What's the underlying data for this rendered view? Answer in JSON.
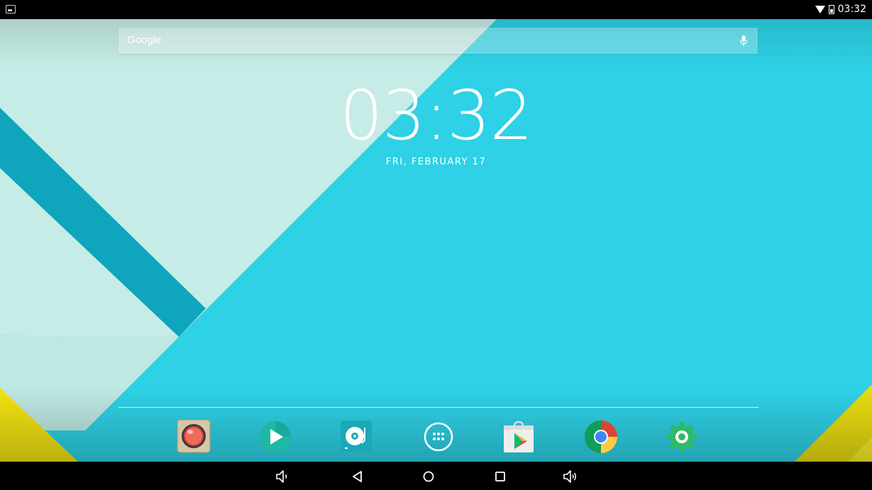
{
  "status_bar": {
    "time": "03:32",
    "icons": [
      "screenshot-notification-icon",
      "wifi-icon",
      "battery-icon"
    ]
  },
  "search": {
    "label": "Google",
    "icon": "mic-icon"
  },
  "clock_widget": {
    "time": "03:32",
    "date": "FRI, FEBRUARY 17"
  },
  "dock": {
    "apps": [
      {
        "name": "camera-app",
        "icon": "camera-lens-icon"
      },
      {
        "name": "video-player-app",
        "icon": "play-icon"
      },
      {
        "name": "music-app",
        "icon": "music-turntable-icon"
      },
      {
        "name": "all-apps",
        "icon": "app-drawer-icon"
      },
      {
        "name": "play-store-app",
        "icon": "play-store-icon"
      },
      {
        "name": "chrome-app",
        "icon": "chrome-icon"
      },
      {
        "name": "settings-app",
        "icon": "settings-gear-icon"
      }
    ]
  },
  "nav_bar": {
    "buttons": [
      "volume-down",
      "back",
      "home",
      "recents",
      "volume-up"
    ]
  },
  "colors": {
    "wallpaper_cyan": "#2ED1E5",
    "wallpaper_mint": "#C5ECE6",
    "stripe_teal": "#0EA5BD",
    "accent_yellow": "#F2E212"
  }
}
